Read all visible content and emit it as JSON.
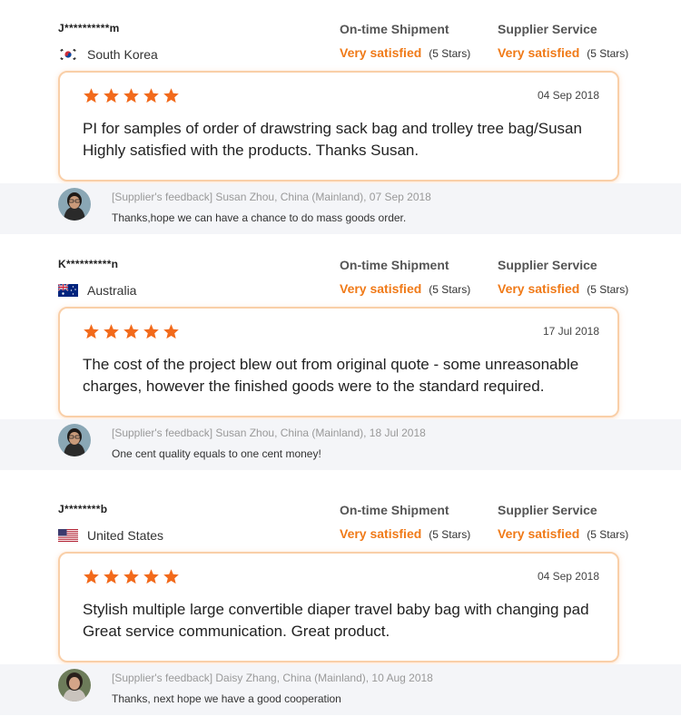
{
  "reviews": [
    {
      "buyer": "J**********m",
      "country": "South Korea",
      "flag_icon": "south-korea-flag-icon",
      "shipment_title": "On-time Shipment",
      "shipment_value": "Very satisfied",
      "shipment_stars": "(5 Stars)",
      "service_title": "Supplier Service",
      "service_value": "Very satisfied",
      "service_stars": "(5 Stars)",
      "rating": 5,
      "date": "04 Sep 2018",
      "comment_line1": "PI for samples of order of drawstring sack bag and trolley tree bag/Susan",
      "comment_line2": "Highly satisfied with the products. Thanks Susan.",
      "feedback_meta": "[Supplier's feedback] Susan Zhou, China (Mainland), 07 Sep 2018",
      "feedback_text": "Thanks,hope we can have a chance to do mass goods order."
    },
    {
      "buyer": "K**********n",
      "country": "Australia",
      "flag_icon": "australia-flag-icon",
      "shipment_title": "On-time Shipment",
      "shipment_value": "Very satisfied",
      "shipment_stars": "(5 Stars)",
      "service_title": "Supplier Service",
      "service_value": "Very satisfied",
      "service_stars": "(5 Stars)",
      "rating": 5,
      "date": "17 Jul 2018",
      "comment_line1": "The cost of the project blew out from original quote - some unreasonable",
      "comment_line2": "charges, however the finished goods were to the standard required.",
      "feedback_meta": "[Supplier's feedback] Susan Zhou, China (Mainland), 18 Jul 2018",
      "feedback_text": "One cent quality equals to one cent money!"
    },
    {
      "buyer": "J********b",
      "country": "United States",
      "flag_icon": "united-states-flag-icon",
      "shipment_title": "On-time Shipment",
      "shipment_value": "Very satisfied",
      "shipment_stars": "(5 Stars)",
      "service_title": "Supplier Service",
      "service_value": "Very satisfied",
      "service_stars": "(5 Stars)",
      "rating": 5,
      "date": "04 Sep 2018",
      "comment_line1": "Stylish multiple large convertible diaper travel baby bag with changing pad",
      "comment_line2": "Great service communication. Great product.",
      "feedback_meta": "[Supplier's feedback] Daisy Zhang, China (Mainland), 10 Aug 2018",
      "feedback_text": "Thanks, next hope we have a good cooperation"
    }
  ],
  "colors": {
    "accent": "#f07a18",
    "star": "#f26a1b",
    "card_border": "#f9cfa8",
    "feedback_bg": "#f4f5f8"
  }
}
